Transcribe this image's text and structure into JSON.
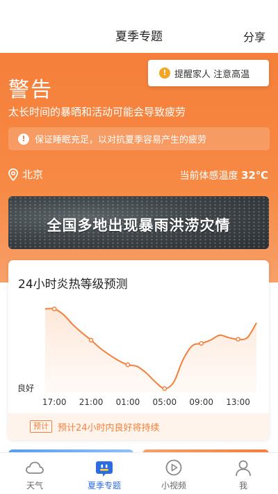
{
  "header": {
    "title": "夏季专题",
    "share_label": "分享"
  },
  "reminder": {
    "text": "提醒家人 注意高温",
    "icon": "alert-icon"
  },
  "warning": {
    "title": "警告",
    "description": "太长时间的暴晒和活动可能会导致疲劳",
    "tip": "保证睡眠充足，以对抗夏季容易产生的疲劳"
  },
  "location": {
    "city": "北京",
    "icon": "location-pin-icon"
  },
  "feels_like": {
    "label": "当前体感温度",
    "value": "32℃"
  },
  "banner": {
    "text": "全国多地出现暴雨洪涝灾情"
  },
  "forecast": {
    "title": "24小时炎热等级预测",
    "footer_tag": "预计",
    "footer_text": "预计24小时内良好将持续",
    "chart_data": {
      "type": "line",
      "title": "24小时炎热等级预测",
      "categories": [
        "17:00",
        "21:00",
        "01:00",
        "05:00",
        "09:00",
        "13:00"
      ],
      "y_level_label": "良好",
      "series": [
        {
          "x": [
            "16:00",
            "17:00",
            "18:00",
            "19:00",
            "20:00",
            "21:00",
            "22:00",
            "23:00",
            "00:00",
            "01:00",
            "02:00",
            "03:00",
            "04:00",
            "05:00",
            "06:00",
            "07:00",
            "08:00",
            "09:00",
            "10:00",
            "11:00",
            "12:00",
            "13:00",
            "14:00",
            "15:00"
          ],
          "values": [
            100,
            100,
            93,
            81,
            71,
            62,
            52,
            44,
            37,
            32,
            30,
            22,
            11,
            3,
            11,
            38,
            55,
            58,
            62,
            68,
            65,
            63,
            65,
            83
          ]
        }
      ],
      "ylim": [
        0,
        100
      ],
      "grid": false
    }
  },
  "tabs": [
    {
      "label": "天气",
      "icon": "weather-cloud-icon",
      "active": false
    },
    {
      "label": "夏季专题",
      "icon": "summer-topic-icon",
      "active": true
    },
    {
      "label": "小视频",
      "icon": "play-video-icon",
      "active": false
    },
    {
      "label": "我",
      "icon": "profile-icon",
      "active": false
    }
  ],
  "colors": {
    "accent": "#f57f3a",
    "tab_active": "#2d6be0"
  }
}
